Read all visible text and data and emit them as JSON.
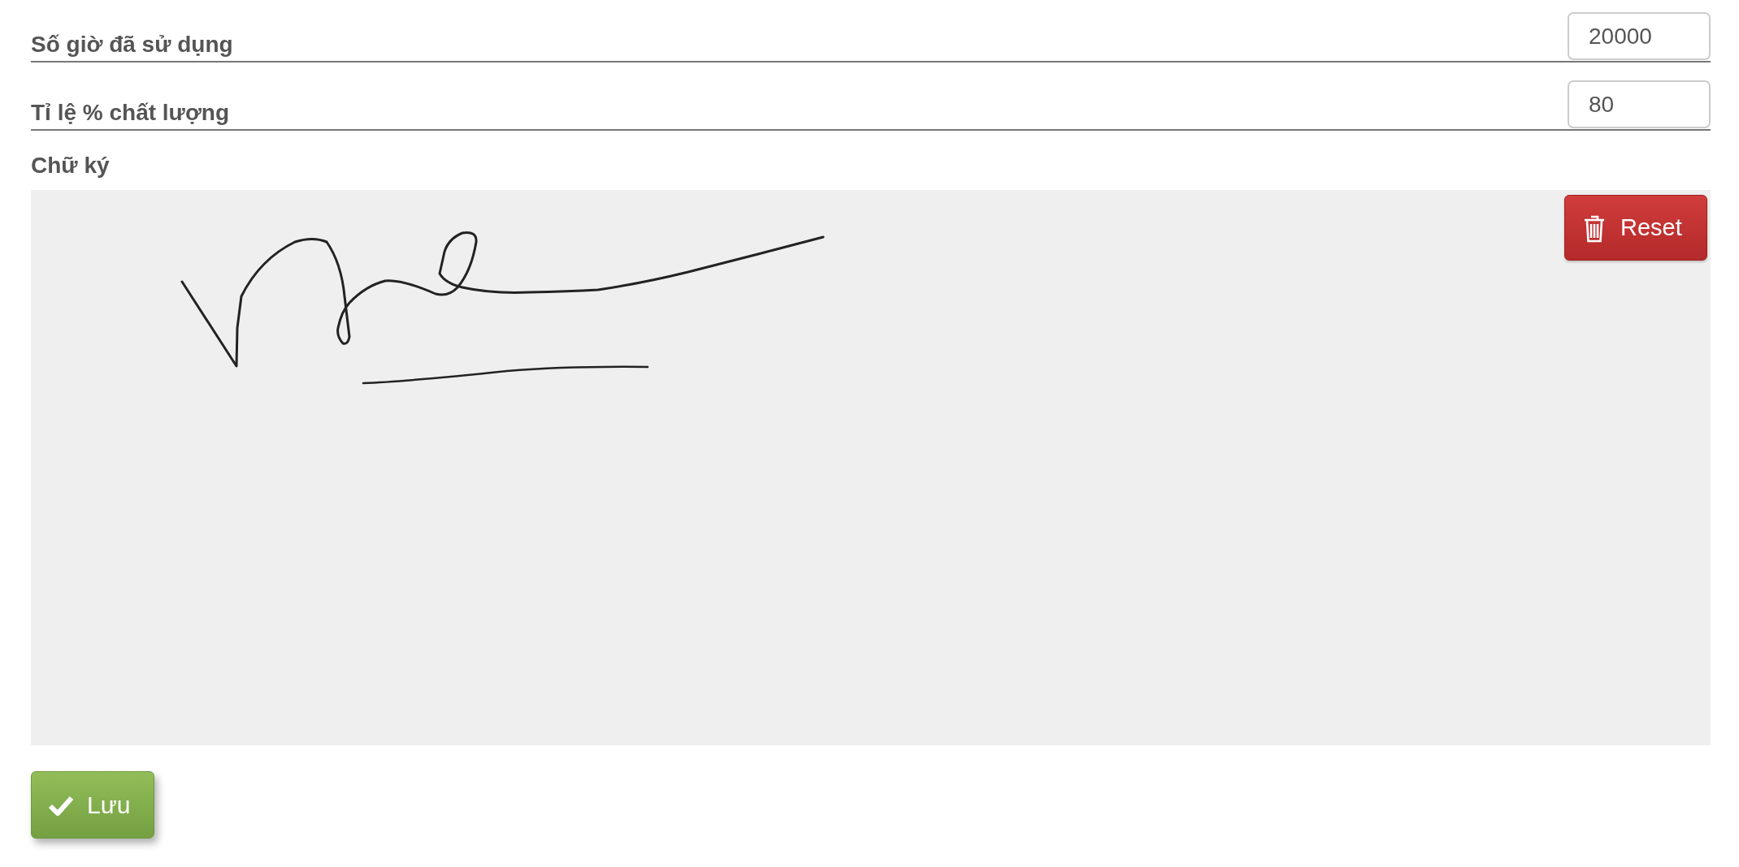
{
  "fields": [
    {
      "label": "Số giờ đã sử dụng",
      "value": "20000"
    },
    {
      "label": "Tỉ lệ % chất lượng",
      "value": "80"
    }
  ],
  "signature": {
    "label": "Chữ ký",
    "reset_button": "Reset"
  },
  "save_button": "Lưu"
}
